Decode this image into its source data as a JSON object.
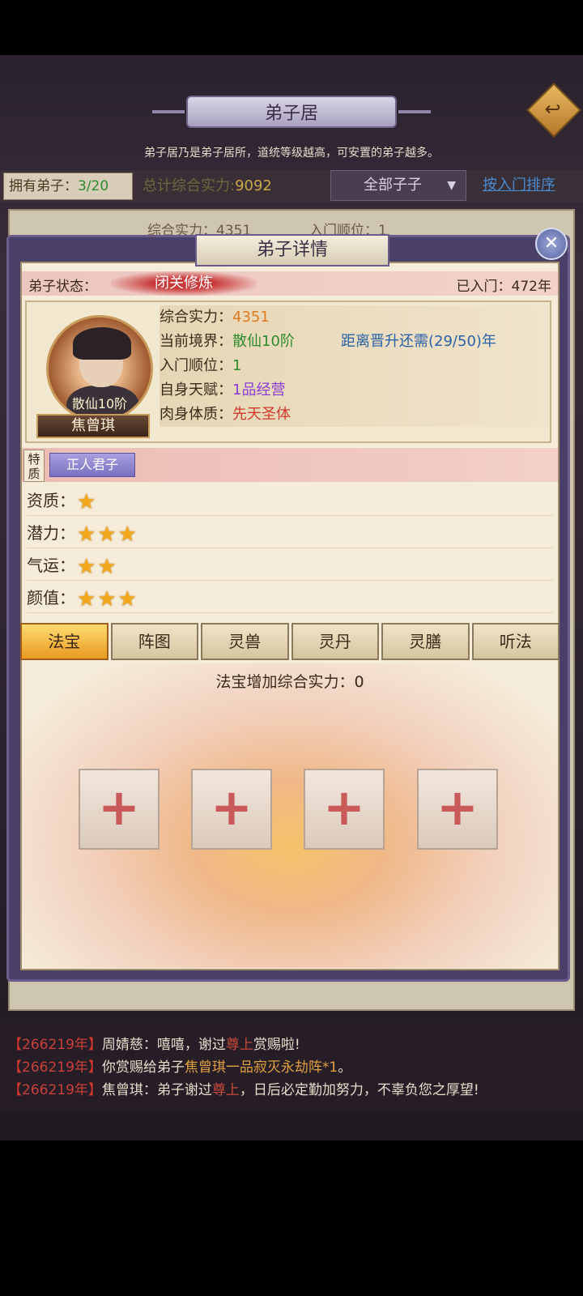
{
  "header": {
    "title": "弟子居",
    "description": "弟子居乃是弟子居所，道统等级越高，可安置的弟子越多。",
    "back_icon": "back-arrow-icon"
  },
  "summary": {
    "own_label": "拥有弟子：",
    "own_value": "3/20",
    "total_label": "总计综合实力:",
    "total_value": "9092",
    "filter_value": "全部子子",
    "sort_link": "按入门排序",
    "list_ghost_power": "综合实力：4351",
    "list_ghost_order": "入门顺位：1"
  },
  "modal": {
    "title": "弟子详情",
    "status_label": "弟子状态：",
    "status_value": "闭关修炼",
    "joined": "已入门：472年",
    "disciple": {
      "rank": "散仙10阶",
      "name": "焦曾琪"
    },
    "attrs": [
      {
        "label": "综合实力：",
        "value": "4351"
      },
      {
        "label": "当前境界：",
        "value": "散仙10阶",
        "extra": "距离晋升还需(29/50)年"
      },
      {
        "label": "入门顺位：",
        "value": "1"
      },
      {
        "label": "自身天赋：",
        "value": "1品经营"
      },
      {
        "label": "肉身体质：",
        "value": "先天圣体"
      }
    ],
    "trait_label": "特质",
    "trait_value": "正人君子",
    "ratings": [
      {
        "label": "资质：",
        "stars": 1
      },
      {
        "label": "潜力：",
        "stars": 3
      },
      {
        "label": "气运：",
        "stars": 2
      },
      {
        "label": "颜值：",
        "stars": 3
      }
    ],
    "tabs": [
      "法宝",
      "阵图",
      "灵兽",
      "灵丹",
      "灵膳",
      "听法"
    ],
    "active_tab": "法宝",
    "treasure_label": "法宝增加综合实力：0",
    "slots": 4
  },
  "chat": [
    {
      "prefix": "【",
      "year": "266219年",
      "suffix": "】",
      "text1": "周婧慈：嘻嘻，谢过",
      "hl": "尊上",
      "text2": "赏赐啦!"
    },
    {
      "prefix": "【",
      "year": "266219年",
      "suffix": "】",
      "text1": "你赏赐给弟子",
      "hl": "焦曾琪一品寂灭永劫阵*1",
      "text2": "。"
    },
    {
      "prefix": "【",
      "year": "266219年",
      "suffix": "】",
      "text1": "焦曾琪：弟子谢过",
      "hl": "尊上",
      "text2": "，日后必定勤加努力，不辜负您之厚望!"
    }
  ]
}
